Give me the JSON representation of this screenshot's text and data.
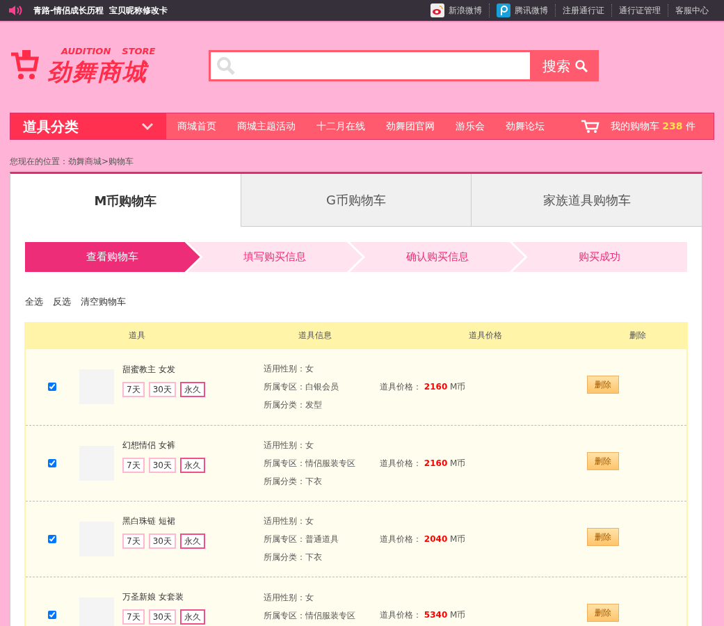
{
  "top_bar": {
    "left_links": [
      "青路-情侣成长历程",
      "宝贝昵称修改卡"
    ],
    "right_links": [
      {
        "label": "新浪微博",
        "kind": "sina"
      },
      {
        "label": "腾讯微博",
        "kind": "tencent"
      },
      {
        "label": "注册通行证",
        "kind": "text"
      },
      {
        "label": "通行证管理",
        "kind": "text"
      },
      {
        "label": "客服中心",
        "kind": "text"
      }
    ]
  },
  "logo": {
    "tagline": [
      "AUDITION",
      "STORE"
    ],
    "title": "劲舞商城"
  },
  "search": {
    "button": "搜索"
  },
  "nav": {
    "category": "道具分类",
    "items": [
      "商城首页",
      "商城主题活动",
      "十二月在线",
      "劲舞团官网",
      "游乐会",
      "劲舞论坛"
    ],
    "cart": {
      "label": "我的购物车",
      "count": "238",
      "unit": "件"
    }
  },
  "breadcrumb": "您现在的位置：劲舞商城>购物车",
  "tabs": [
    {
      "label": "M币购物车",
      "selected": true
    },
    {
      "label": "G币购物车",
      "selected": false
    },
    {
      "label": "家族道具购物车",
      "selected": false
    }
  ],
  "steps": [
    {
      "label": "查看购物车",
      "selected": true
    },
    {
      "label": "填写购买信息",
      "selected": false
    },
    {
      "label": "确认购买信息",
      "selected": false
    },
    {
      "label": "购买成功",
      "selected": false
    }
  ],
  "actions": [
    "全选",
    "反选",
    "清空购物车"
  ],
  "table": {
    "columns": [
      "道具",
      "道具信息",
      "道具价格",
      "删除"
    ],
    "rows": [
      {
        "checked": true,
        "name": "甜蜜教主 女发",
        "durations": [
          {
            "label": "7天",
            "selected": false
          },
          {
            "label": "30天",
            "selected": false
          },
          {
            "label": "永久",
            "selected": true
          }
        ],
        "info": [
          "适用性别：女",
          "所属专区：白银会员",
          "所属分类：发型"
        ],
        "price_label": "道具价格：",
        "price": "2160",
        "currency": "M币",
        "delete": "删除"
      },
      {
        "checked": true,
        "name": "幻想情侣 女裤",
        "durations": [
          {
            "label": "7天",
            "selected": false
          },
          {
            "label": "30天",
            "selected": false
          },
          {
            "label": "永久",
            "selected": true
          }
        ],
        "info": [
          "适用性别：女",
          "所属专区：情侣服装专区",
          "所属分类：下衣"
        ],
        "price_label": "道具价格：",
        "price": "2160",
        "currency": "M币",
        "delete": "删除"
      },
      {
        "checked": true,
        "name": "黑白珠链 短裙",
        "durations": [
          {
            "label": "7天",
            "selected": false
          },
          {
            "label": "30天",
            "selected": false
          },
          {
            "label": "永久",
            "selected": true
          }
        ],
        "info": [
          "适用性别：女",
          "所属专区：普通道具",
          "所属分类：下衣"
        ],
        "price_label": "道具价格：",
        "price": "2040",
        "currency": "M币",
        "delete": "删除"
      },
      {
        "checked": true,
        "name": "万圣新娘 女套装",
        "durations": [
          {
            "label": "7天",
            "selected": false
          },
          {
            "label": "30天",
            "selected": false
          },
          {
            "label": "永久",
            "selected": true
          }
        ],
        "info": [
          "适用性别：女",
          "所属专区：情侣服装专区"
        ],
        "price_label": "道具价格：",
        "price": "5340",
        "currency": "M币",
        "delete": "删除"
      }
    ]
  }
}
